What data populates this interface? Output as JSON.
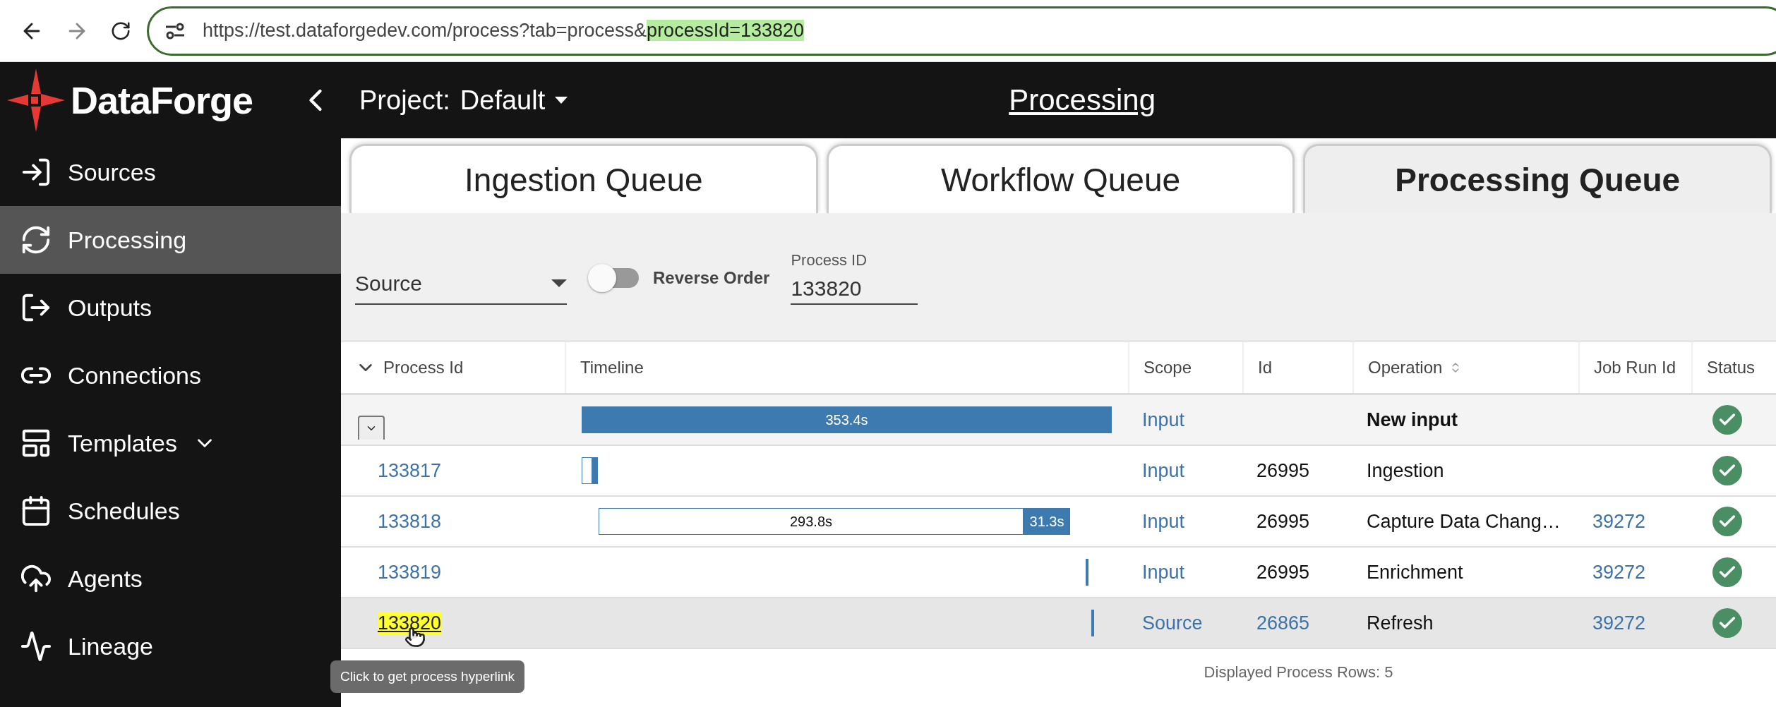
{
  "browser": {
    "url": "https://test.dataforgedev.com/process?tab=process&",
    "url_highlight": "processId=133820"
  },
  "brand": {
    "name": "DataForge"
  },
  "header": {
    "project_label": "Project:",
    "project_value": "Default",
    "title": "Processing"
  },
  "sidebar": {
    "items": [
      {
        "label": "Sources",
        "selected": false,
        "kind": "plain"
      },
      {
        "label": "Processing",
        "selected": true,
        "kind": "plain"
      },
      {
        "label": "Outputs",
        "selected": false,
        "kind": "plain"
      },
      {
        "label": "Connections",
        "selected": false,
        "kind": "plain"
      },
      {
        "label": "Templates",
        "selected": false,
        "kind": "submenu"
      },
      {
        "label": "Schedules",
        "selected": false,
        "kind": "plain"
      },
      {
        "label": "Agents",
        "selected": false,
        "kind": "plain"
      },
      {
        "label": "Lineage",
        "selected": false,
        "kind": "plain"
      }
    ]
  },
  "tabs": [
    {
      "label": "Ingestion Queue",
      "selected": false
    },
    {
      "label": "Workflow Queue",
      "selected": false
    },
    {
      "label": "Processing Queue",
      "selected": true
    }
  ],
  "filters": {
    "select_value": "Source",
    "toggle": {
      "label": "Reverse Order",
      "on": false
    },
    "process_id": {
      "label": "Process ID",
      "value": "133820"
    }
  },
  "table": {
    "columns": [
      {
        "label": "Process Id",
        "kind": "expand"
      },
      {
        "label": "Timeline",
        "kind": "plain"
      },
      {
        "label": "Scope",
        "kind": "plain"
      },
      {
        "label": "Id",
        "kind": "plain"
      },
      {
        "label": "Operation",
        "kind": "sortable"
      },
      {
        "label": "Job Run Id",
        "kind": "plain"
      },
      {
        "label": "Status",
        "kind": "plain"
      }
    ],
    "rows": [
      {
        "kind": "group",
        "timeline": [
          "353.4s"
        ],
        "scope": "Input",
        "operation": "New input"
      },
      {
        "kind": "item",
        "process_id": "133817",
        "timeline": [],
        "scope": "Input",
        "id": "26995",
        "id_link": false,
        "operation": "Ingestion",
        "selected": false
      },
      {
        "kind": "item",
        "process_id": "133818",
        "timeline": [
          "293.8s",
          "31.3s"
        ],
        "scope": "Input",
        "id": "26995",
        "id_link": false,
        "operation": "Capture Data Chang…",
        "job_run_id": "39272",
        "selected": false
      },
      {
        "kind": "item",
        "process_id": "133819",
        "timeline": [],
        "scope": "Input",
        "id": "26995",
        "id_link": false,
        "operation": "Enrichment",
        "job_run_id": "39272",
        "selected": false
      },
      {
        "kind": "item",
        "process_id": "133820",
        "timeline": [],
        "scope": "Source",
        "id": "26865",
        "id_link": true,
        "operation": "Refresh",
        "job_run_id": "39272",
        "selected": true
      }
    ],
    "footer": "Displayed Process Rows: 5"
  },
  "tooltip": "Click to get process hyperlink"
}
